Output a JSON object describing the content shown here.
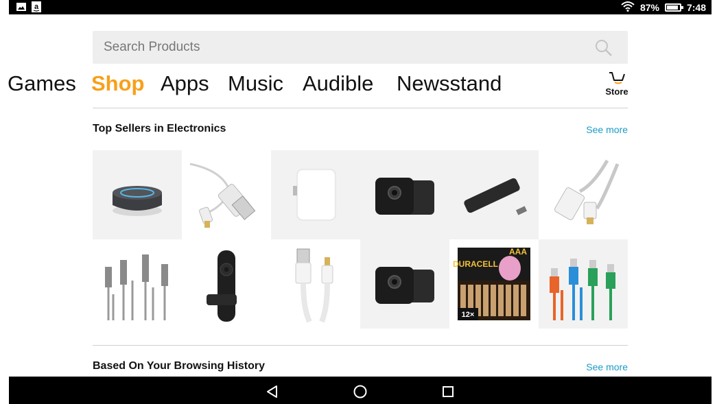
{
  "status_bar": {
    "battery_percent": "87%",
    "battery_level": 0.87,
    "time": "7:48",
    "left_icons": [
      "image-icon",
      "amazon-a-icon"
    ],
    "right_icons": [
      "wifi-icon",
      "battery-icon"
    ]
  },
  "search": {
    "placeholder": "Search Products",
    "icon": "search-icon"
  },
  "tabs": [
    {
      "label": "Games",
      "active": false
    },
    {
      "label": "Shop",
      "active": true
    },
    {
      "label": "Apps",
      "active": false
    },
    {
      "label": "Music",
      "active": false
    },
    {
      "label": "Audible",
      "active": false
    },
    {
      "label": "Newsstand",
      "active": false
    }
  ],
  "store": {
    "label": "Store",
    "icon": "cart-icon"
  },
  "sections": [
    {
      "title": "Top Sellers in Electronics",
      "see_more": "See more"
    },
    {
      "title": "Based On Your Browsing History",
      "see_more": "See more"
    }
  ],
  "products": [
    {
      "name": "smart-speaker"
    },
    {
      "name": "usb-lightning-cable"
    },
    {
      "name": "smart-plug"
    },
    {
      "name": "security-camera"
    },
    {
      "name": "streaming-stick"
    },
    {
      "name": "braided-lightning-cable"
    },
    {
      "name": "usb-c-cable-pack"
    },
    {
      "name": "streaming-stick-remote"
    },
    {
      "name": "white-lightning-cable"
    },
    {
      "name": "security-camera-2"
    },
    {
      "name": "aaa-batteries",
      "brand_text": "DURACELL",
      "label": "AAA",
      "badge": "12×"
    },
    {
      "name": "colored-cable-pack"
    }
  ],
  "nav_bar": {
    "icons": [
      "back-icon",
      "home-icon",
      "recents-icon"
    ]
  },
  "colors": {
    "accent": "#f8a01b",
    "link": "#1a9bc7",
    "search_bg": "#eeeeee",
    "bars": "#000000"
  }
}
